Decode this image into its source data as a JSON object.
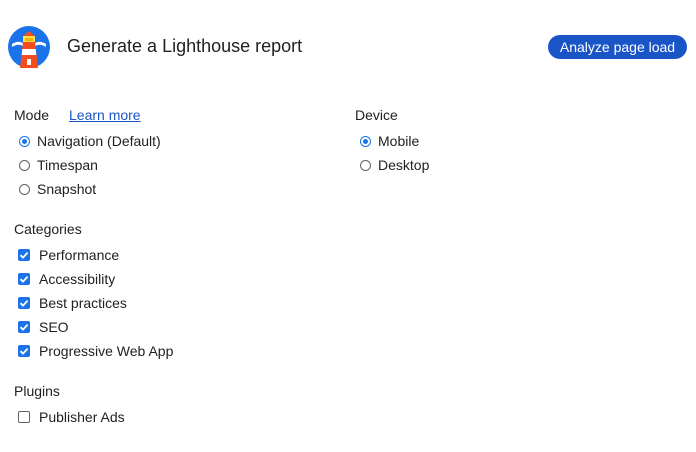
{
  "header": {
    "title": "Generate a Lighthouse report",
    "analyze_button": "Analyze page load",
    "logo_icon": "lighthouse-logo-icon"
  },
  "mode": {
    "label": "Mode",
    "learn_more": "Learn more",
    "options": [
      {
        "label": "Navigation (Default)",
        "selected": true
      },
      {
        "label": "Timespan",
        "selected": false
      },
      {
        "label": "Snapshot",
        "selected": false
      }
    ]
  },
  "device": {
    "label": "Device",
    "options": [
      {
        "label": "Mobile",
        "selected": true
      },
      {
        "label": "Desktop",
        "selected": false
      }
    ]
  },
  "categories": {
    "label": "Categories",
    "items": [
      {
        "label": "Performance",
        "checked": true
      },
      {
        "label": "Accessibility",
        "checked": true
      },
      {
        "label": "Best practices",
        "checked": true
      },
      {
        "label": "SEO",
        "checked": true
      },
      {
        "label": "Progressive Web App",
        "checked": true
      }
    ]
  },
  "plugins": {
    "label": "Plugins",
    "items": [
      {
        "label": "Publisher Ads",
        "checked": false
      }
    ]
  },
  "colors": {
    "accent": "#1a73e8",
    "button": "#1a55c7",
    "logo_background": "#1a73e8",
    "logo_tower": "#f44b21"
  }
}
